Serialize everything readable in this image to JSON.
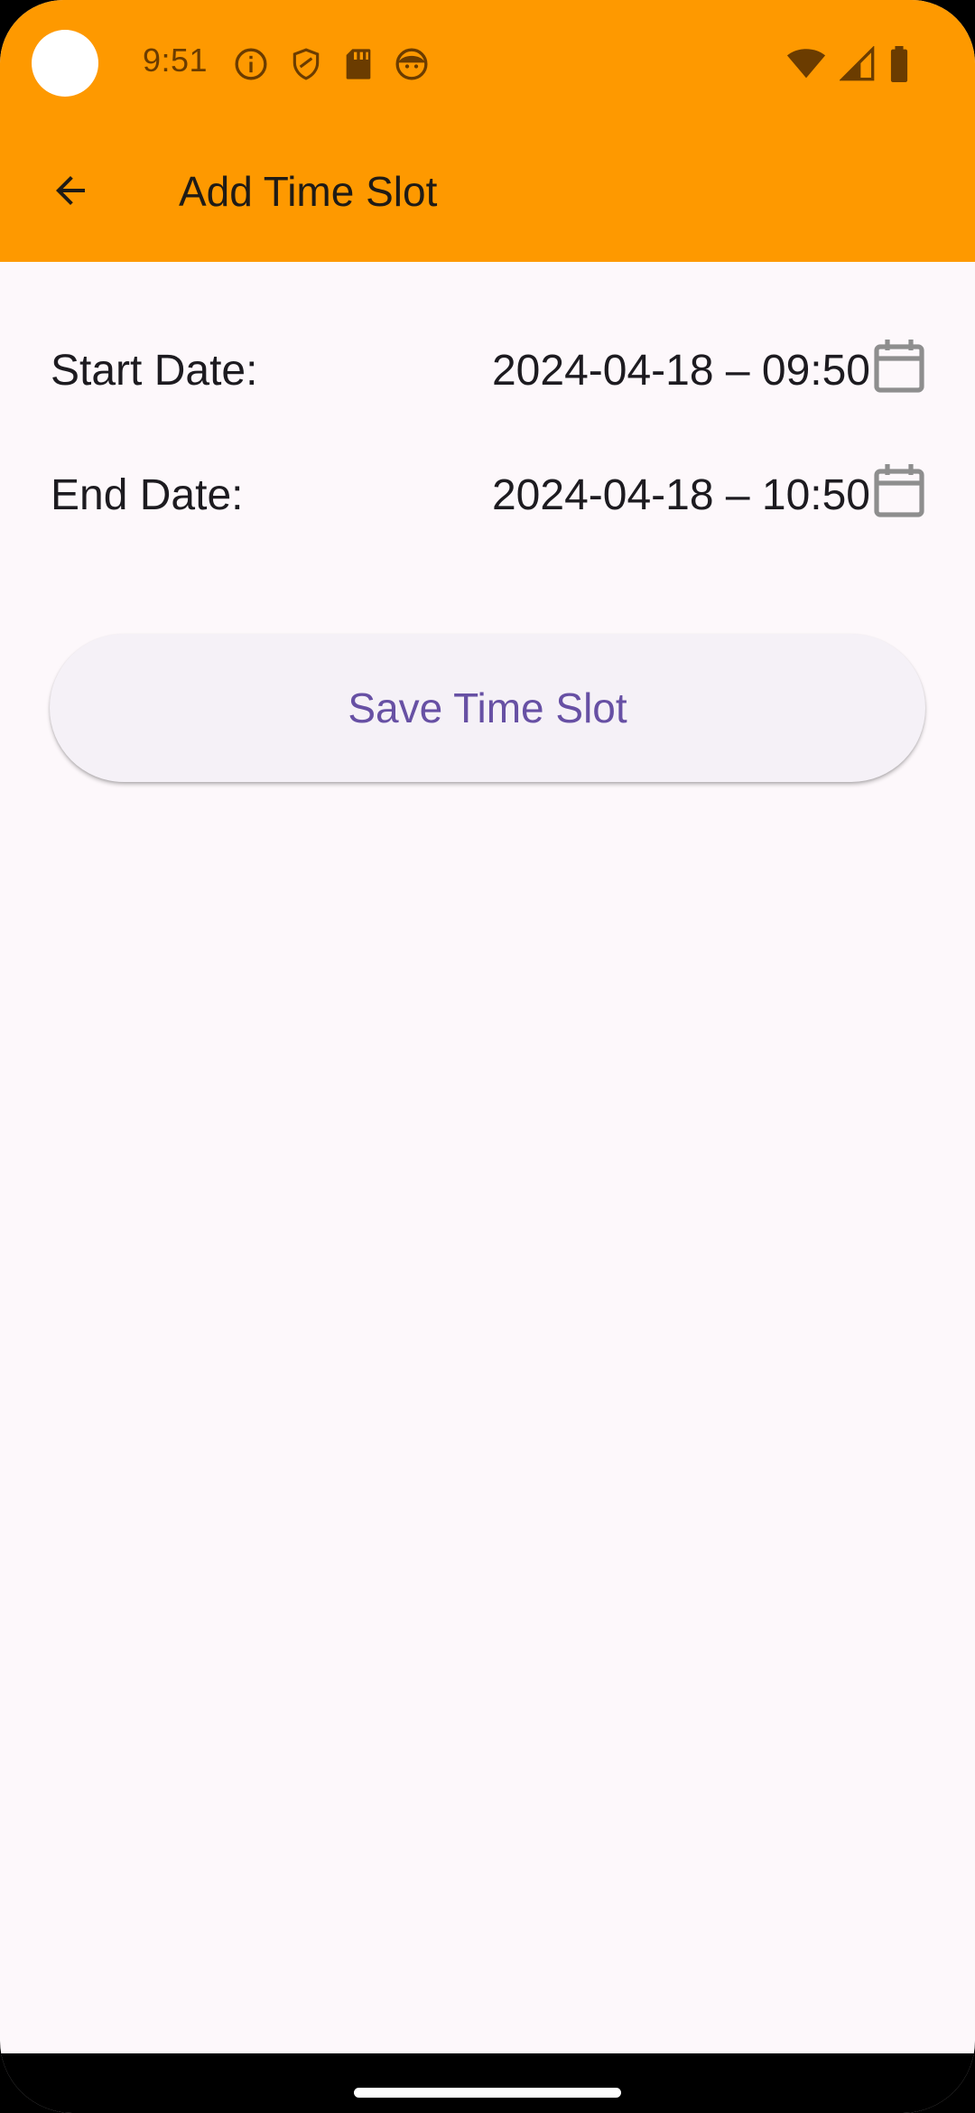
{
  "status_bar": {
    "time": "9:51",
    "left_icons": [
      "info-icon",
      "shield-icon",
      "sd-card-icon",
      "face-icon"
    ],
    "right_icons": [
      "wifi-icon",
      "signal-icon",
      "battery-icon"
    ],
    "color": "#fe9900"
  },
  "app_bar": {
    "title": "Add Time Slot",
    "back_icon": "arrow-back-icon",
    "color": "#fe9900"
  },
  "form": {
    "start": {
      "label": "Start Date:",
      "value": "2024-04-18 – 09:50",
      "icon": "calendar-icon"
    },
    "end": {
      "label": "End Date:",
      "value": "2024-04-18 – 10:50",
      "icon": "calendar-icon"
    }
  },
  "save_button": {
    "label": "Save Time Slot",
    "color": "#6750a4"
  }
}
